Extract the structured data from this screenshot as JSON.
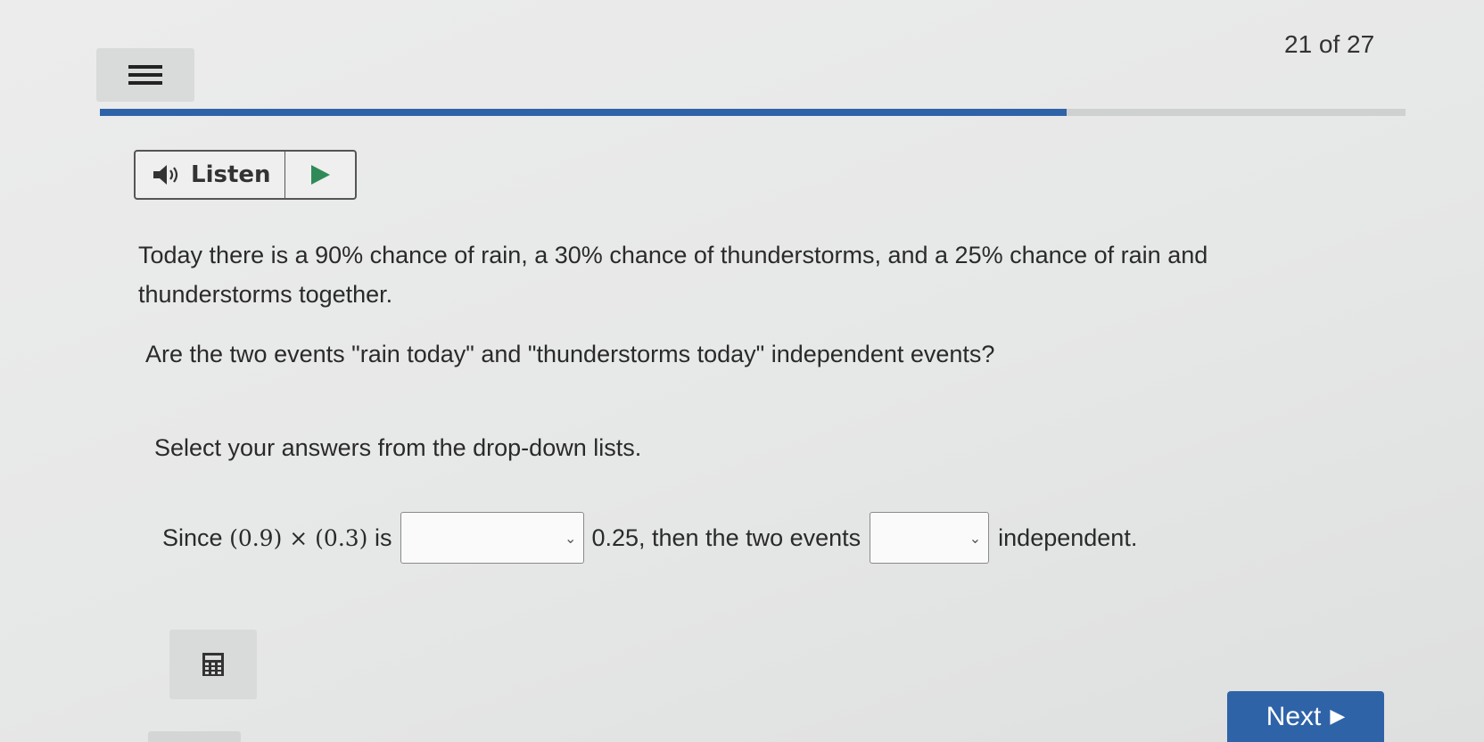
{
  "header": {
    "menu_icon": "hamburger-menu-icon",
    "question_counter": "21 of 27",
    "progress_fraction": 0.7407
  },
  "listen": {
    "label": "Listen",
    "speaker_icon": "speaker-icon",
    "play_icon": "play-icon",
    "accent_color": "#2e8b57"
  },
  "question": {
    "paragraph_1": "Today there is a 90% chance of rain, a 30% chance of thunderstorms, and a 25% chance of rain and thunderstorms together.",
    "paragraph_2": "Are the two events \"rain today\" and \"thunderstorms today\" independent events?",
    "instructions": "Select your answers from the drop-down lists."
  },
  "answer": {
    "prefix": "Since",
    "expression": "(0.9) × (0.3)",
    "is": "is",
    "middle": "0.25, then the two events",
    "suffix": "independent.",
    "dropdown_1_value": "",
    "dropdown_2_value": ""
  },
  "tools": {
    "calculator_icon": "calculator-icon"
  },
  "navigation": {
    "next_label": "Next",
    "next_icon": "triangle-right-icon",
    "brand_color": "#2f63a8"
  }
}
